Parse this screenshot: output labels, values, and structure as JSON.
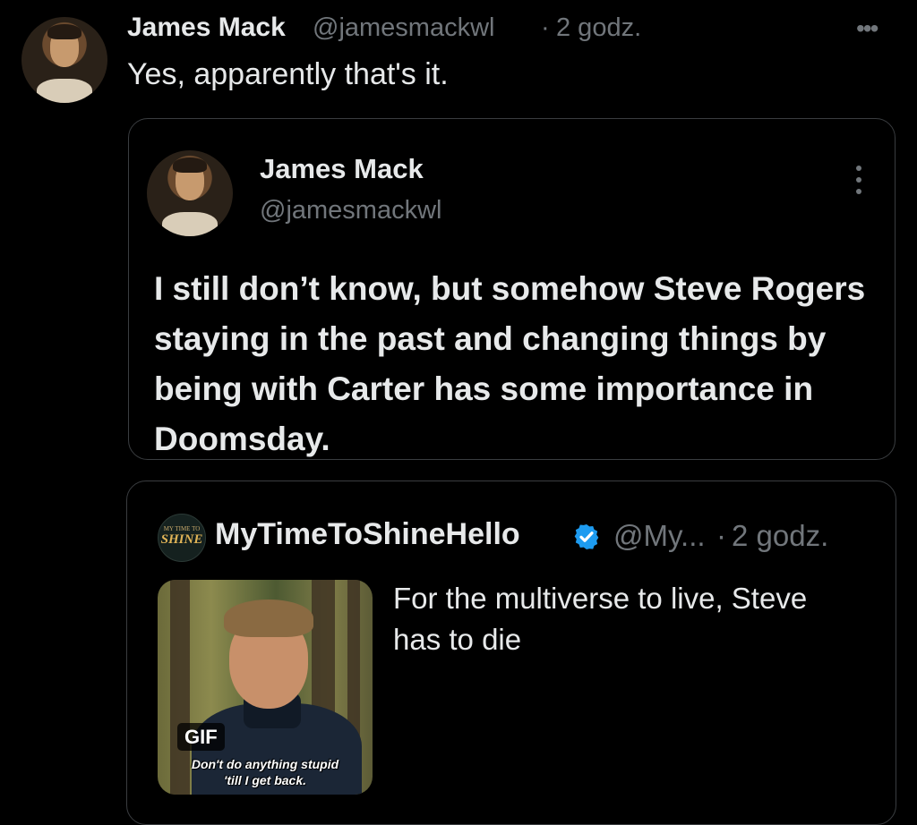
{
  "reply": {
    "author_name": "James Mack",
    "author_handle": "@jamesmackwl",
    "dot": "·",
    "time": "2 godz.",
    "more_icon": "more-horizontal-icon",
    "text": "Yes, apparently that's it."
  },
  "quoted_post": {
    "author_name": "James Mack",
    "author_handle": "@jamesmackwl",
    "more_icon": "more-vertical-icon",
    "text": "I still don’t know, but somehow Steve Rogers staying in the past and changing things by being with Carter has some importance in Doomsday."
  },
  "nested_quote": {
    "logo_small": "MY TIME TO",
    "logo_big": "SHINE",
    "author_name": "MyTimeToShineHello",
    "verified_icon": "verified-badge-icon",
    "verified_color": "#1d9bf0",
    "author_handle": "@My...",
    "dot": "·",
    "time": "2 godz.",
    "media": {
      "badge": "GIF",
      "caption_line1": "Don't do anything stupid",
      "caption_line2": "'till I get back."
    },
    "text": "For the multiverse to live, Steve has to die"
  }
}
